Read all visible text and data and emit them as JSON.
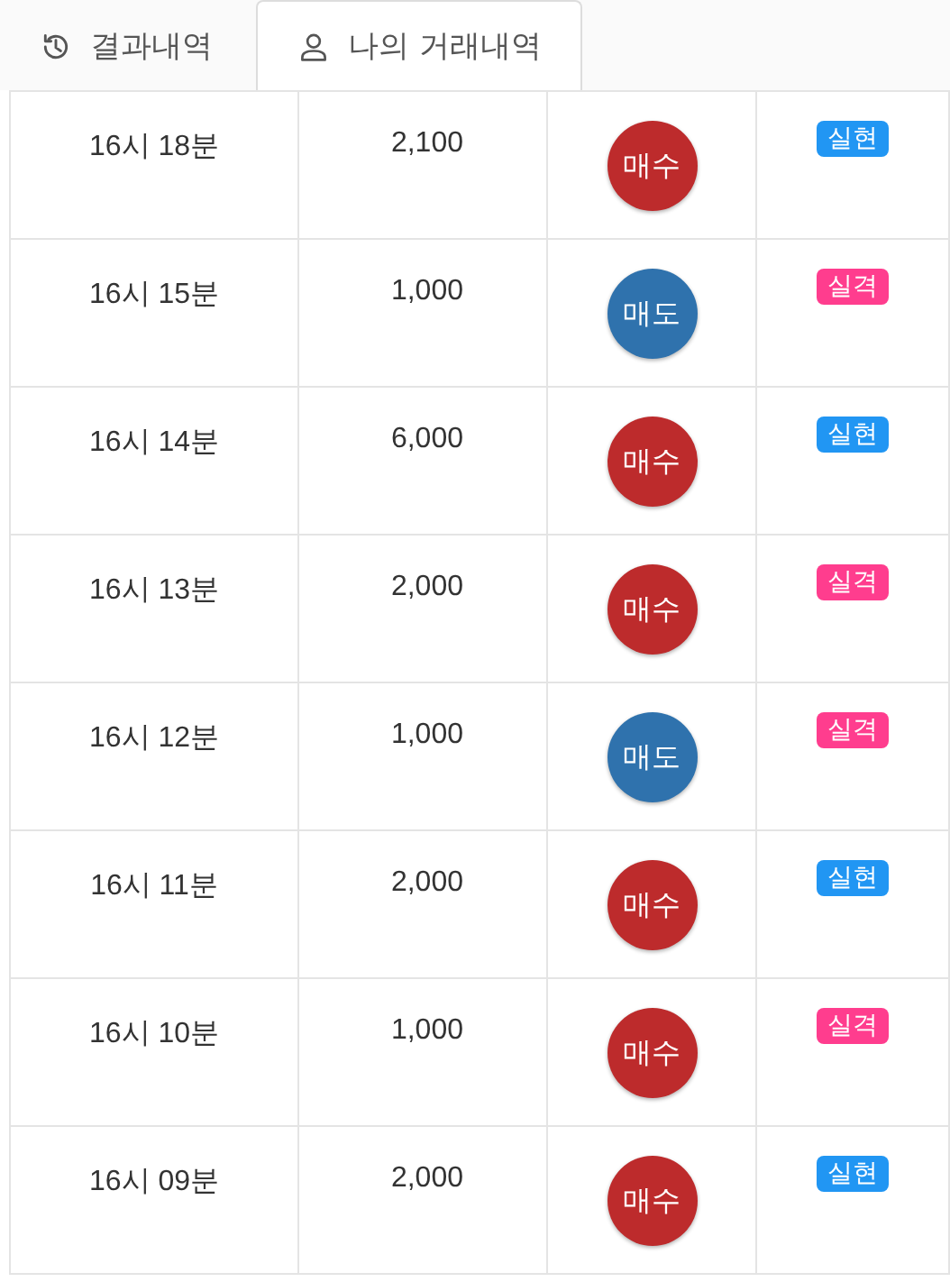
{
  "tabs": [
    {
      "label": "결과내역",
      "kind": "history",
      "selected": false
    },
    {
      "label": "나의 거래내역",
      "kind": "account",
      "selected": true
    }
  ],
  "rows": [
    {
      "time": "16시 18분",
      "amount": "2,100",
      "side": {
        "label": "매수",
        "kind": "buy"
      },
      "result": {
        "label": "실현",
        "kind": "win"
      }
    },
    {
      "time": "16시 15분",
      "amount": "1,000",
      "side": {
        "label": "매도",
        "kind": "sell"
      },
      "result": {
        "label": "실격",
        "kind": "fail"
      }
    },
    {
      "time": "16시 14분",
      "amount": "6,000",
      "side": {
        "label": "매수",
        "kind": "buy"
      },
      "result": {
        "label": "실현",
        "kind": "win"
      }
    },
    {
      "time": "16시 13분",
      "amount": "2,000",
      "side": {
        "label": "매수",
        "kind": "buy"
      },
      "result": {
        "label": "실격",
        "kind": "fail"
      }
    },
    {
      "time": "16시 12분",
      "amount": "1,000",
      "side": {
        "label": "매도",
        "kind": "sell"
      },
      "result": {
        "label": "실격",
        "kind": "fail"
      }
    },
    {
      "time": "16시 11분",
      "amount": "2,000",
      "side": {
        "label": "매수",
        "kind": "buy"
      },
      "result": {
        "label": "실현",
        "kind": "win"
      }
    },
    {
      "time": "16시 10분",
      "amount": "1,000",
      "side": {
        "label": "매수",
        "kind": "buy"
      },
      "result": {
        "label": "실격",
        "kind": "fail"
      }
    },
    {
      "time": "16시 09분",
      "amount": "2,000",
      "side": {
        "label": "매수",
        "kind": "buy"
      },
      "result": {
        "label": "실현",
        "kind": "win"
      }
    }
  ]
}
